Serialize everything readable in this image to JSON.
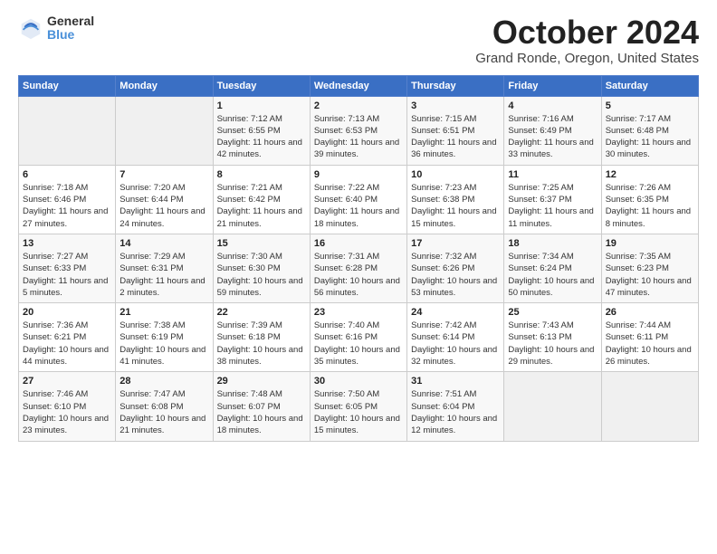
{
  "header": {
    "logo_general": "General",
    "logo_blue": "Blue",
    "month": "October 2024",
    "location": "Grand Ronde, Oregon, United States"
  },
  "weekdays": [
    "Sunday",
    "Monday",
    "Tuesday",
    "Wednesday",
    "Thursday",
    "Friday",
    "Saturday"
  ],
  "weeks": [
    [
      {
        "day": "",
        "sunrise": "",
        "sunset": "",
        "daylight": ""
      },
      {
        "day": "",
        "sunrise": "",
        "sunset": "",
        "daylight": ""
      },
      {
        "day": "1",
        "sunrise": "Sunrise: 7:12 AM",
        "sunset": "Sunset: 6:55 PM",
        "daylight": "Daylight: 11 hours and 42 minutes."
      },
      {
        "day": "2",
        "sunrise": "Sunrise: 7:13 AM",
        "sunset": "Sunset: 6:53 PM",
        "daylight": "Daylight: 11 hours and 39 minutes."
      },
      {
        "day": "3",
        "sunrise": "Sunrise: 7:15 AM",
        "sunset": "Sunset: 6:51 PM",
        "daylight": "Daylight: 11 hours and 36 minutes."
      },
      {
        "day": "4",
        "sunrise": "Sunrise: 7:16 AM",
        "sunset": "Sunset: 6:49 PM",
        "daylight": "Daylight: 11 hours and 33 minutes."
      },
      {
        "day": "5",
        "sunrise": "Sunrise: 7:17 AM",
        "sunset": "Sunset: 6:48 PM",
        "daylight": "Daylight: 11 hours and 30 minutes."
      }
    ],
    [
      {
        "day": "6",
        "sunrise": "Sunrise: 7:18 AM",
        "sunset": "Sunset: 6:46 PM",
        "daylight": "Daylight: 11 hours and 27 minutes."
      },
      {
        "day": "7",
        "sunrise": "Sunrise: 7:20 AM",
        "sunset": "Sunset: 6:44 PM",
        "daylight": "Daylight: 11 hours and 24 minutes."
      },
      {
        "day": "8",
        "sunrise": "Sunrise: 7:21 AM",
        "sunset": "Sunset: 6:42 PM",
        "daylight": "Daylight: 11 hours and 21 minutes."
      },
      {
        "day": "9",
        "sunrise": "Sunrise: 7:22 AM",
        "sunset": "Sunset: 6:40 PM",
        "daylight": "Daylight: 11 hours and 18 minutes."
      },
      {
        "day": "10",
        "sunrise": "Sunrise: 7:23 AM",
        "sunset": "Sunset: 6:38 PM",
        "daylight": "Daylight: 11 hours and 15 minutes."
      },
      {
        "day": "11",
        "sunrise": "Sunrise: 7:25 AM",
        "sunset": "Sunset: 6:37 PM",
        "daylight": "Daylight: 11 hours and 11 minutes."
      },
      {
        "day": "12",
        "sunrise": "Sunrise: 7:26 AM",
        "sunset": "Sunset: 6:35 PM",
        "daylight": "Daylight: 11 hours and 8 minutes."
      }
    ],
    [
      {
        "day": "13",
        "sunrise": "Sunrise: 7:27 AM",
        "sunset": "Sunset: 6:33 PM",
        "daylight": "Daylight: 11 hours and 5 minutes."
      },
      {
        "day": "14",
        "sunrise": "Sunrise: 7:29 AM",
        "sunset": "Sunset: 6:31 PM",
        "daylight": "Daylight: 11 hours and 2 minutes."
      },
      {
        "day": "15",
        "sunrise": "Sunrise: 7:30 AM",
        "sunset": "Sunset: 6:30 PM",
        "daylight": "Daylight: 10 hours and 59 minutes."
      },
      {
        "day": "16",
        "sunrise": "Sunrise: 7:31 AM",
        "sunset": "Sunset: 6:28 PM",
        "daylight": "Daylight: 10 hours and 56 minutes."
      },
      {
        "day": "17",
        "sunrise": "Sunrise: 7:32 AM",
        "sunset": "Sunset: 6:26 PM",
        "daylight": "Daylight: 10 hours and 53 minutes."
      },
      {
        "day": "18",
        "sunrise": "Sunrise: 7:34 AM",
        "sunset": "Sunset: 6:24 PM",
        "daylight": "Daylight: 10 hours and 50 minutes."
      },
      {
        "day": "19",
        "sunrise": "Sunrise: 7:35 AM",
        "sunset": "Sunset: 6:23 PM",
        "daylight": "Daylight: 10 hours and 47 minutes."
      }
    ],
    [
      {
        "day": "20",
        "sunrise": "Sunrise: 7:36 AM",
        "sunset": "Sunset: 6:21 PM",
        "daylight": "Daylight: 10 hours and 44 minutes."
      },
      {
        "day": "21",
        "sunrise": "Sunrise: 7:38 AM",
        "sunset": "Sunset: 6:19 PM",
        "daylight": "Daylight: 10 hours and 41 minutes."
      },
      {
        "day": "22",
        "sunrise": "Sunrise: 7:39 AM",
        "sunset": "Sunset: 6:18 PM",
        "daylight": "Daylight: 10 hours and 38 minutes."
      },
      {
        "day": "23",
        "sunrise": "Sunrise: 7:40 AM",
        "sunset": "Sunset: 6:16 PM",
        "daylight": "Daylight: 10 hours and 35 minutes."
      },
      {
        "day": "24",
        "sunrise": "Sunrise: 7:42 AM",
        "sunset": "Sunset: 6:14 PM",
        "daylight": "Daylight: 10 hours and 32 minutes."
      },
      {
        "day": "25",
        "sunrise": "Sunrise: 7:43 AM",
        "sunset": "Sunset: 6:13 PM",
        "daylight": "Daylight: 10 hours and 29 minutes."
      },
      {
        "day": "26",
        "sunrise": "Sunrise: 7:44 AM",
        "sunset": "Sunset: 6:11 PM",
        "daylight": "Daylight: 10 hours and 26 minutes."
      }
    ],
    [
      {
        "day": "27",
        "sunrise": "Sunrise: 7:46 AM",
        "sunset": "Sunset: 6:10 PM",
        "daylight": "Daylight: 10 hours and 23 minutes."
      },
      {
        "day": "28",
        "sunrise": "Sunrise: 7:47 AM",
        "sunset": "Sunset: 6:08 PM",
        "daylight": "Daylight: 10 hours and 21 minutes."
      },
      {
        "day": "29",
        "sunrise": "Sunrise: 7:48 AM",
        "sunset": "Sunset: 6:07 PM",
        "daylight": "Daylight: 10 hours and 18 minutes."
      },
      {
        "day": "30",
        "sunrise": "Sunrise: 7:50 AM",
        "sunset": "Sunset: 6:05 PM",
        "daylight": "Daylight: 10 hours and 15 minutes."
      },
      {
        "day": "31",
        "sunrise": "Sunrise: 7:51 AM",
        "sunset": "Sunset: 6:04 PM",
        "daylight": "Daylight: 10 hours and 12 minutes."
      },
      {
        "day": "",
        "sunrise": "",
        "sunset": "",
        "daylight": ""
      },
      {
        "day": "",
        "sunrise": "",
        "sunset": "",
        "daylight": ""
      }
    ]
  ]
}
